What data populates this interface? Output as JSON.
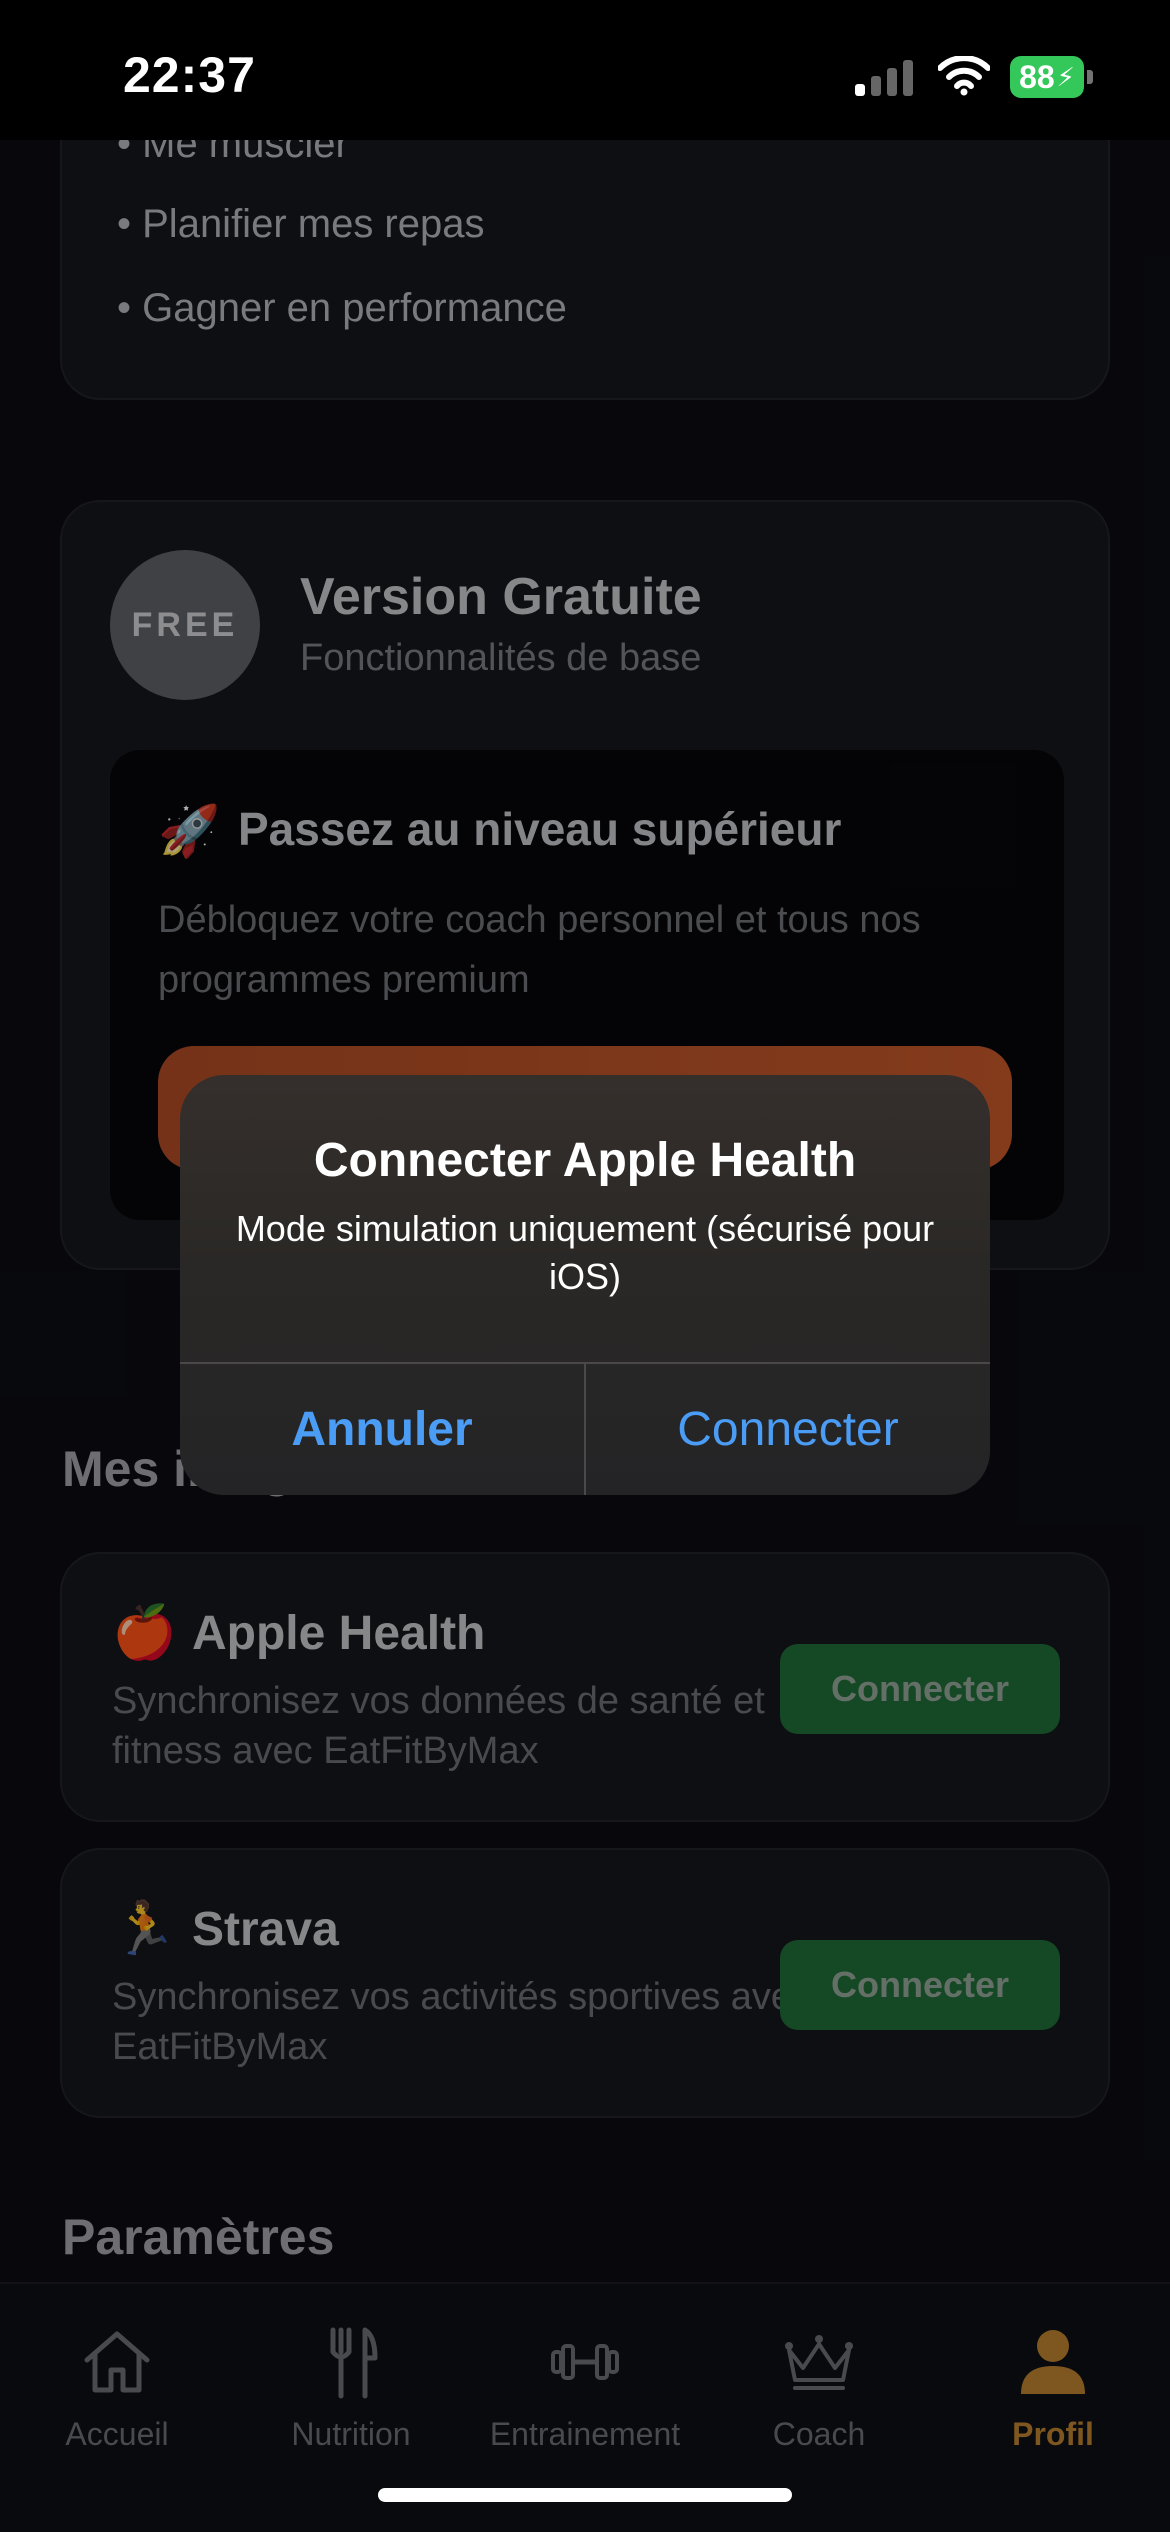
{
  "status_bar": {
    "time": "22:37",
    "battery": "88"
  },
  "goals": {
    "items": [
      "Me muscler",
      "Planifier mes repas",
      "Gagner en performance"
    ]
  },
  "plan": {
    "badge": "FREE",
    "title": "Version Gratuite",
    "subtitle": "Fonctionnalités de base",
    "upgrade": {
      "icon": "rocket-icon",
      "title": "Passez au niveau supérieur",
      "description": "Débloquez votre coach personnel et tous nos programmes premium"
    }
  },
  "integrations": {
    "section_title": "Mes intégrations",
    "items": [
      {
        "icon": "apple-icon",
        "name": "Apple Health",
        "description": "Synchronisez vos données de santé et fitness avec EatFitByMax",
        "button": "Connecter"
      },
      {
        "icon": "runner-icon",
        "name": "Strava",
        "description": "Synchronisez vos activités sportives avec EatFitByMax",
        "button": "Connecter"
      }
    ]
  },
  "settings": {
    "section_title": "Paramètres"
  },
  "alert": {
    "title": "Connecter Apple Health",
    "message": "Mode simulation uniquement (sécurisé pour iOS)",
    "cancel": "Annuler",
    "confirm": "Connecter"
  },
  "tabs": [
    {
      "icon": "home-icon",
      "label": "Accueil",
      "active": false
    },
    {
      "icon": "fork-knife-icon",
      "label": "Nutrition",
      "active": false
    },
    {
      "icon": "dumbbell-icon",
      "label": "Entrainement",
      "active": false
    },
    {
      "icon": "crown-icon",
      "label": "Coach",
      "active": false
    },
    {
      "icon": "person-icon",
      "label": "Profil",
      "active": true
    }
  ],
  "colors": {
    "accent": "#b8802f",
    "connect_green": "#1f6b35",
    "alert_blue": "#4b9cf5",
    "upgrade_orange": "#c2572a"
  }
}
